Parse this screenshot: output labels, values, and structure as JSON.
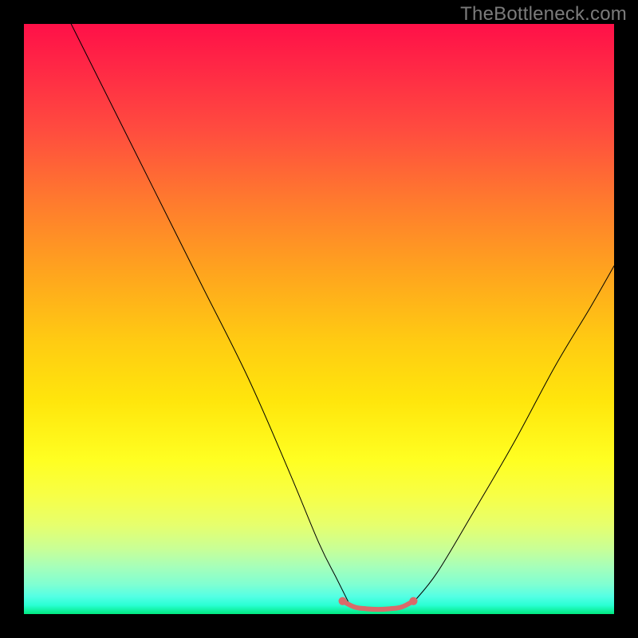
{
  "watermark": "TheBottleneck.com",
  "chart_data": {
    "type": "line",
    "title": "",
    "xlabel": "",
    "ylabel": "",
    "xlim": [
      0,
      100
    ],
    "ylim": [
      0,
      100
    ],
    "grid": false,
    "series": [
      {
        "name": "curve-left",
        "x": [
          8,
          15,
          22,
          30,
          38,
          45,
          50,
          53,
          55
        ],
        "y": [
          100,
          86,
          72,
          56,
          40,
          24,
          12,
          6,
          2
        ],
        "stroke": "#000000",
        "stroke_width": 1
      },
      {
        "name": "curve-right",
        "x": [
          66,
          70,
          76,
          83,
          90,
          96,
          100
        ],
        "y": [
          2,
          7,
          17,
          29,
          42,
          52,
          59
        ],
        "stroke": "#000000",
        "stroke_width": 1
      },
      {
        "name": "valley-band",
        "x": [
          54,
          56,
          58,
          60,
          62,
          64,
          66
        ],
        "y": [
          2.2,
          1.2,
          0.9,
          0.8,
          0.9,
          1.2,
          2.2
        ],
        "stroke": "#d96a6a",
        "stroke_width": 6,
        "end_dots": true
      }
    ],
    "background_gradient": {
      "direction": "vertical",
      "stops": [
        {
          "pos": 0.0,
          "color": "#ff1048"
        },
        {
          "pos": 0.3,
          "color": "#ff7a2e"
        },
        {
          "pos": 0.64,
          "color": "#ffe60c"
        },
        {
          "pos": 0.85,
          "color": "#e6ff6e"
        },
        {
          "pos": 1.0,
          "color": "#00e97f"
        }
      ]
    }
  }
}
